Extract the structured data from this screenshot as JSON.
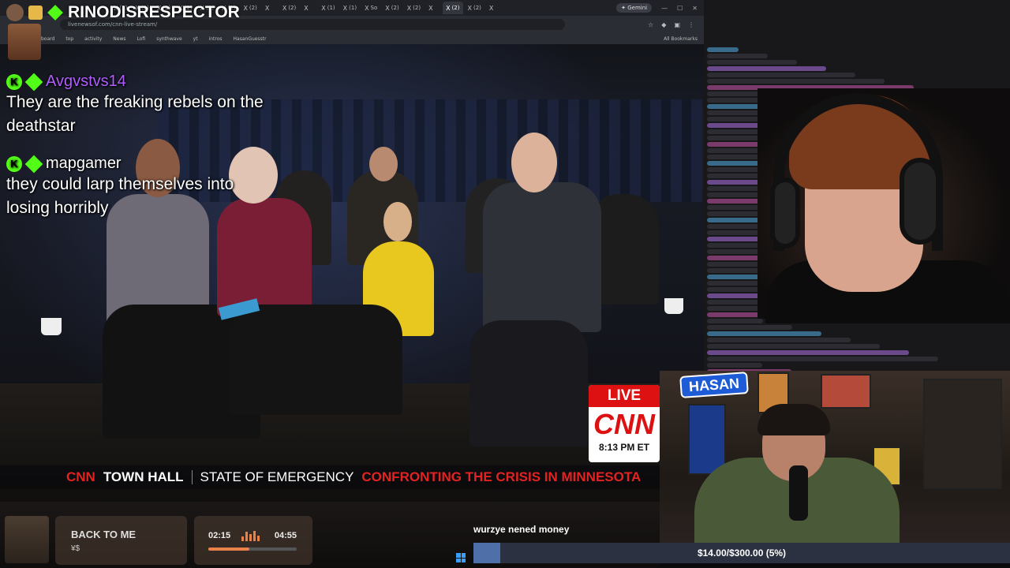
{
  "browser": {
    "tabs": [
      "X",
      "X",
      "X",
      "X",
      "X",
      "X",
      "X",
      "X",
      "X",
      "X",
      "X",
      "X",
      "X",
      "X",
      "X",
      "X",
      "X",
      "X",
      "X"
    ],
    "tab_labels": [
      "(2)",
      "(2)",
      "(2)",
      "(2)",
      "(2)",
      "(2)",
      "(2)",
      "",
      "(2)",
      "",
      "(1)",
      "(1)",
      "So",
      "(2)",
      "(2)",
      "",
      "(2)",
      "(2)",
      ""
    ],
    "gemini_label": "Gemini",
    "url": "livenewsof.com/cnn-live-stream/",
    "bookmarks": [
      "board",
      "top",
      "activity",
      "News",
      "Lofi",
      "synthwave",
      "yt",
      "intros",
      "HasanGuesstr"
    ],
    "all_bookmarks": "All Bookmarks"
  },
  "overlay_chat": {
    "top_user": "RINODISRESPECTOR",
    "messages": [
      {
        "user": "Avgvstvs14",
        "user_color": "#b05cff",
        "text": "They are the freaking rebels on the deathstar"
      },
      {
        "user": "mapgamer",
        "user_color": "#ffffff",
        "text": "they could larp themselves into losing horribly"
      }
    ],
    "badge_letter": "K"
  },
  "broadcast": {
    "network": "CNN",
    "program": "TOWN HALL",
    "state": "STATE OF EMERGENCY",
    "crisis": "CONFRONTING THE CRISIS IN MINNESOTA",
    "live_label": "LIVE",
    "live_logo": "CNN",
    "time": "8:13 PM ET"
  },
  "music": {
    "title": "BACK TO ME",
    "artist": "¥$",
    "elapsed": "02:15",
    "duration": "04:55",
    "progress": 0.46
  },
  "donations": {
    "latest_donor": "wurzye nened money",
    "goal_text": "$14.00/$300.00 (5%)",
    "goal_fraction": 0.05
  },
  "cam2": {
    "logo": "HASAN"
  },
  "colors": {
    "kick_green": "#53fc18",
    "cnn_red": "#d11111",
    "accent_orange": "#e8824a"
  }
}
